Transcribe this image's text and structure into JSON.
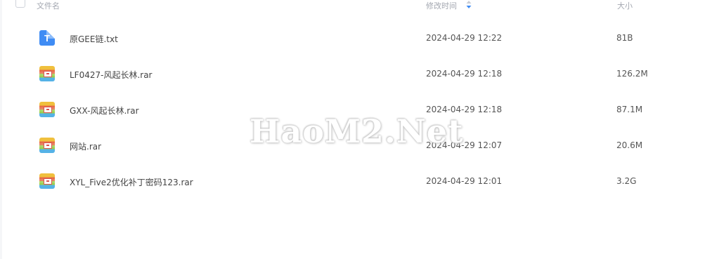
{
  "header": {
    "name_label": "文件名",
    "time_label": "修改时间",
    "size_label": "大小",
    "sort_icon": "sort-descending-icon"
  },
  "files": [
    {
      "name": "原GEE链.txt",
      "modified": "2024-04-29 12:22",
      "size": "81B",
      "type": "txt",
      "icon_glyph": "T"
    },
    {
      "name": "LF0427-风起长林.rar",
      "modified": "2024-04-29 12:18",
      "size": "126.2M",
      "type": "rar"
    },
    {
      "name": "GXX-风起长林.rar",
      "modified": "2024-04-29 12:18",
      "size": "87.1M",
      "type": "rar"
    },
    {
      "name": "网站.rar",
      "modified": "2024-04-29 12:07",
      "size": "20.6M",
      "type": "rar"
    },
    {
      "name": "XYL_Five2优化补丁密码123.rar",
      "modified": "2024-04-29 12:01",
      "size": "3.2G",
      "type": "rar"
    }
  ],
  "watermark": "HaoM2.Net",
  "colors": {
    "txt_icon": "#3f8cf4",
    "header_text": "#a3a7b0",
    "sort_accent": "#3f8cf4"
  }
}
